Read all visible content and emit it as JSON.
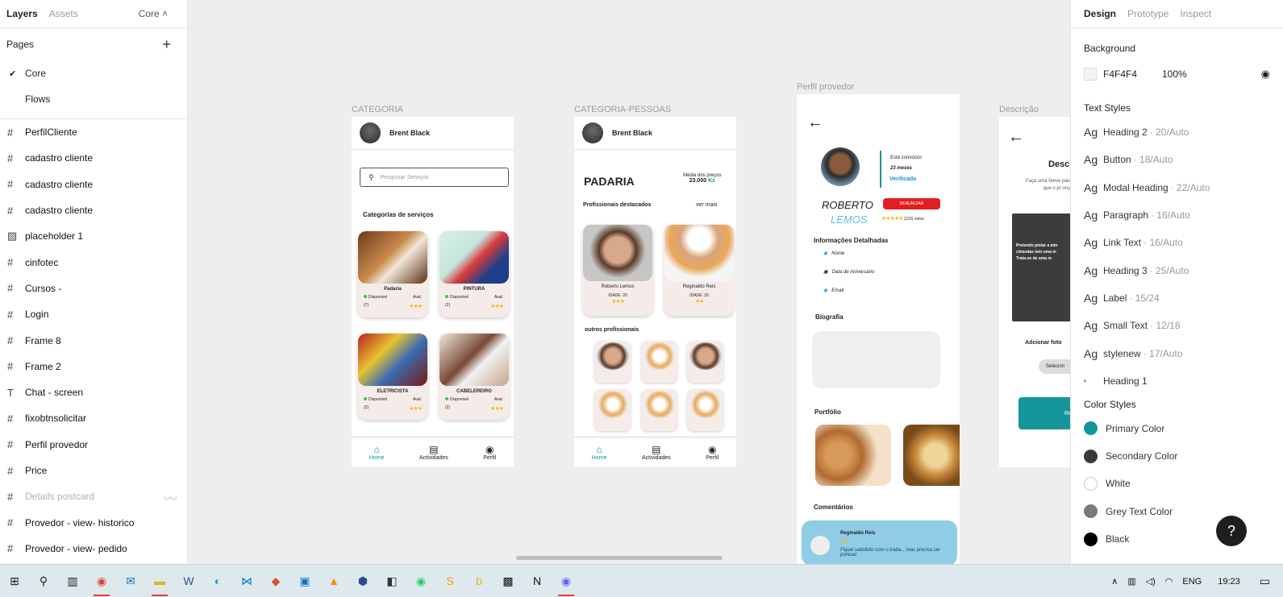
{
  "left_panel": {
    "tabs": [
      "Layers",
      "Assets"
    ],
    "page_selector": "Core ˄",
    "pages_label": "Pages",
    "pages": [
      {
        "label": "Core",
        "checked": true
      },
      {
        "label": "Flows",
        "checked": false
      }
    ],
    "layers": [
      {
        "label": "PerfilCliente",
        "icon": "frame-icon"
      },
      {
        "label": "cadastro cliente",
        "icon": "frame-icon"
      },
      {
        "label": "cadastro cliente",
        "icon": "frame-icon"
      },
      {
        "label": "cadastro cliente",
        "icon": "frame-icon"
      },
      {
        "label": "placeholder 1",
        "icon": "image-icon"
      },
      {
        "label": "cinfotec",
        "icon": "frame-icon"
      },
      {
        "label": "Cursos -",
        "icon": "frame-icon"
      },
      {
        "label": "Login",
        "icon": "frame-icon"
      },
      {
        "label": "Frame 8",
        "icon": "frame-icon"
      },
      {
        "label": "Frame 2",
        "icon": "frame-icon"
      },
      {
        "label": "Chat - screen",
        "icon": "text-icon"
      },
      {
        "label": "fixobtnsolicitar",
        "icon": "frame-icon"
      },
      {
        "label": "Perfil provedor",
        "icon": "frame-icon"
      },
      {
        "label": "Price",
        "icon": "frame-icon"
      },
      {
        "label": "Details postcard",
        "icon": "frame-icon",
        "hidden": true
      },
      {
        "label": "Provedor - view- historico",
        "icon": "frame-icon"
      },
      {
        "label": "Provedor - view- pedido",
        "icon": "frame-icon"
      }
    ]
  },
  "right_panel": {
    "tabs": [
      "Design",
      "Prototype",
      "Inspect"
    ],
    "background_label": "Background",
    "background": {
      "hex": "F4F4F4",
      "opacity": "100%"
    },
    "text_styles_label": "Text Styles",
    "text_styles": [
      {
        "name": "Heading 2",
        "meta": "· 20/Auto"
      },
      {
        "name": "Button",
        "meta": "· 18/Auto"
      },
      {
        "name": "Modal Heading",
        "meta": "· 22/Auto"
      },
      {
        "name": "Paragraph",
        "meta": "· 16/Auto"
      },
      {
        "name": "Link Text",
        "meta": "· 16/Auto"
      },
      {
        "name": "Heading 3",
        "meta": "· 25/Auto"
      },
      {
        "name": "Label",
        "meta": "· 15/24"
      },
      {
        "name": "Small Text",
        "meta": "· 12/18"
      },
      {
        "name": "stylenew",
        "meta": "· 17/Auto"
      }
    ],
    "heading1": "Heading 1",
    "color_styles_label": "Color Styles",
    "color_styles": [
      {
        "name": "Primary Color",
        "color": "#16959b"
      },
      {
        "name": "Secondary Color",
        "color": "#3a3a3a"
      },
      {
        "name": "White",
        "color": "#ffffff"
      },
      {
        "name": "Grey Text Color",
        "color": "#7a7a7a"
      },
      {
        "name": "Black",
        "color": "#000000"
      }
    ],
    "help": "?"
  },
  "canvas": {
    "frame1": {
      "label": "CATEGORIA",
      "user": "Brent Black",
      "search_placeholder": "Pesquisar Serviços",
      "section": "Categorias de serviços",
      "cards": [
        {
          "name": "Padaria",
          "status": "Disponivel",
          "count": "(7)",
          "aval": "Aval."
        },
        {
          "name": "PINTURA",
          "status": "Disponivel",
          "count": "(2)",
          "aval": "Aval."
        },
        {
          "name": "ELETRICISTA",
          "status": "Disponivel",
          "count": "(2)",
          "aval": "Aval."
        },
        {
          "name": "CABELEREIRO",
          "status": "Disponivel",
          "count": "(2)",
          "aval": "Aval."
        }
      ],
      "nav": [
        "Home",
        "Actividades",
        "Perfil"
      ]
    },
    "frame2": {
      "label": "CATEGORIA-PESSOAS",
      "user": "Brent Black",
      "title": "PADARIA",
      "avg_label": "Média dos preços",
      "avg_value": "23.000",
      "avg_unit": "Kz",
      "featured": "Profissionais destacados",
      "see_more": "ver mais",
      "pros": [
        {
          "name": "Roberto Lemos",
          "age": "IDADE: 20"
        },
        {
          "name": "Reginaldo Reis",
          "age": "IDADE: 20"
        }
      ],
      "others": "outros profissionais",
      "nav": [
        "Home",
        "Actividades",
        "Perfil"
      ]
    },
    "frame3": {
      "label": "Perfil provedor",
      "since": "Está connosco",
      "months": "23 meses",
      "verified": "Verificado",
      "first": "ROBERTO",
      "last": "LEMOS",
      "report": "DENUNCIAR",
      "votes": "(123) votos",
      "info_title": "Informações Detalhadas",
      "info": [
        "Nome",
        "Data de Aniversário",
        "Email"
      ],
      "bio": "Biografia",
      "portfolio": "Portfólio",
      "comments": "Comentários",
      "commenter": "Reginaldo Reis",
      "comment": "Fiquei satisfeito com o traba... mas precisa ser pontual"
    },
    "frame4": {
      "label": "Descrição",
      "title": "Descriç",
      "text": "Faça uma breve para que o pr orça",
      "dark_text": "Pretendo pintar a min cômodas tem uma m Trata-se de uma re",
      "add_photo": "Adcionar foto",
      "select": "Selecion",
      "btn": "Re"
    }
  },
  "taskbar": {
    "time": "19:23",
    "lang": "ENG"
  }
}
